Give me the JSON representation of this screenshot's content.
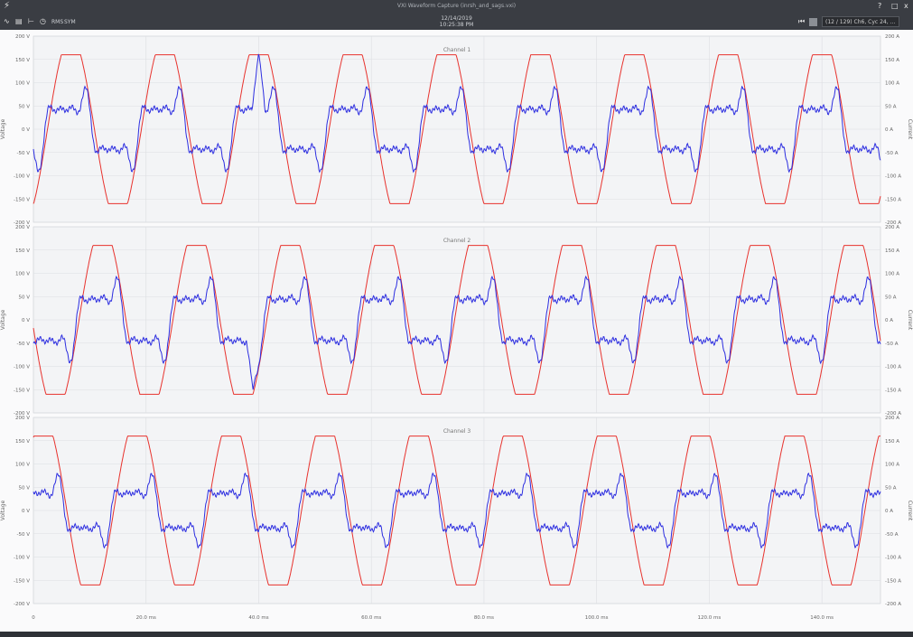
{
  "window": {
    "title": "VXI Waveform Capture (inrsh_and_sags.vxi)",
    "controls": {
      "help": "?",
      "restore": "□",
      "close": "x"
    }
  },
  "toolbar": {
    "rms_label": "RMS",
    "sym_label": "SYM",
    "date": "12/14/2019",
    "time": "10:25:38 PM",
    "nav_value": "(12 / 129) Ch6, Cyc 24, ..."
  },
  "icons": {
    "app": "waveform-app-icon",
    "chart": "waveform-chart-icon",
    "bars": "bar-chart-icon",
    "range": "range-icon",
    "timing": "clock-icon",
    "first": "skip-to-start-icon",
    "record": "record-swatch-icon"
  },
  "colors": {
    "voltage": "#e8322d",
    "current": "#2d2ee0",
    "grid": "#dcdee2",
    "background": "#f3f4f6"
  },
  "chart_data": [
    {
      "type": "line",
      "title": "Channel 1",
      "ylabel": "Voltage",
      "y2label": "Current",
      "xlim": [
        0,
        150.4
      ],
      "ylim": [
        -200,
        200
      ],
      "y2lim": [
        -200,
        200
      ],
      "yticks": [
        "200 V",
        "150 V",
        "100 V",
        "50 V",
        "0 V",
        "-50 V",
        "-100 V",
        "-150 V",
        "-200 V"
      ],
      "y2ticks": [
        "200 A",
        "150 A",
        "100 A",
        "50 A",
        "0 A",
        "-50 A",
        "-100 A",
        "-150 A",
        "-200 A"
      ],
      "grid": true,
      "series": [
        {
          "name": "Voltage",
          "axis": "left",
          "color": "#e8322d",
          "model": {
            "kind": "clipped_sine",
            "peak": 160,
            "period_ms": 16.67,
            "phase_ms": 2.5,
            "clip": 1.25
          }
        },
        {
          "name": "Current",
          "axis": "right",
          "color": "#2d2ee0",
          "model": {
            "kind": "harmonic",
            "period_ms": 16.67,
            "phase_ms": 2.5,
            "fund": 60,
            "h3": 28,
            "h5": 20,
            "h7": 12,
            "offset": 0
          },
          "notable_points": [
            {
              "x": 40.0,
              "y": 165
            }
          ]
        }
      ]
    },
    {
      "type": "line",
      "title": "Channel 2",
      "ylabel": "Voltage",
      "y2label": "Current",
      "xlim": [
        0,
        150.4
      ],
      "ylim": [
        -200,
        200
      ],
      "y2lim": [
        -200,
        200
      ],
      "yticks": [
        "200 V",
        "150 V",
        "100 V",
        "50 V",
        "0 V",
        "-50 V",
        "-100 V",
        "-150 V",
        "-200 V"
      ],
      "y2ticks": [
        "200 A",
        "150 A",
        "100 A",
        "50 A",
        "0 A",
        "-50 A",
        "-100 A",
        "-150 A",
        "-200 A"
      ],
      "grid": true,
      "series": [
        {
          "name": "Voltage",
          "axis": "left",
          "color": "#e8322d",
          "model": {
            "kind": "clipped_sine",
            "peak": 160,
            "period_ms": 16.67,
            "phase_ms": 8.1,
            "clip": 1.25
          }
        },
        {
          "name": "Current",
          "axis": "right",
          "color": "#2d2ee0",
          "model": {
            "kind": "harmonic",
            "period_ms": 16.67,
            "phase_ms": 8.1,
            "fund": 62,
            "h3": 28,
            "h5": 20,
            "h7": 12,
            "offset": 0
          },
          "notable_points": [
            {
              "x": 39.0,
              "y": -150
            }
          ]
        }
      ]
    },
    {
      "type": "line",
      "title": "Channel 3",
      "ylabel": "Voltage",
      "y2label": "Current",
      "xlim": [
        0,
        150.4
      ],
      "ylim": [
        -200,
        200
      ],
      "y2lim": [
        -200,
        200
      ],
      "yticks": [
        "200 V",
        "150 V",
        "100 V",
        "50 V",
        "0 V",
        "-50 V",
        "-100 V",
        "-150 V",
        "-200 V"
      ],
      "y2ticks": [
        "200 A",
        "150 A",
        "100 A",
        "50 A",
        "0 A",
        "-50 A",
        "-100 A",
        "-150 A",
        "-200 A"
      ],
      "grid": true,
      "xticks": [
        {
          "x": 0,
          "label": "0"
        },
        {
          "x": 20,
          "label": "20.0 ms"
        },
        {
          "x": 40,
          "label": "40.0 ms"
        },
        {
          "x": 60,
          "label": "60.0 ms"
        },
        {
          "x": 80,
          "label": "80.0 ms"
        },
        {
          "x": 100,
          "label": "100.0 ms"
        },
        {
          "x": 120,
          "label": "120.0 ms"
        },
        {
          "x": 140,
          "label": "140.0 ms"
        }
      ],
      "series": [
        {
          "name": "Voltage",
          "axis": "left",
          "color": "#e8322d",
          "model": {
            "kind": "clipped_sine",
            "peak": 160,
            "period_ms": 16.67,
            "phase_ms": -2.4,
            "clip": 1.25
          }
        },
        {
          "name": "Current",
          "axis": "right",
          "color": "#2d2ee0",
          "model": {
            "kind": "harmonic",
            "period_ms": 16.67,
            "phase_ms": -2.4,
            "fund": 52,
            "h3": 24,
            "h5": 18,
            "h7": 10,
            "offset": 0
          }
        }
      ]
    }
  ]
}
